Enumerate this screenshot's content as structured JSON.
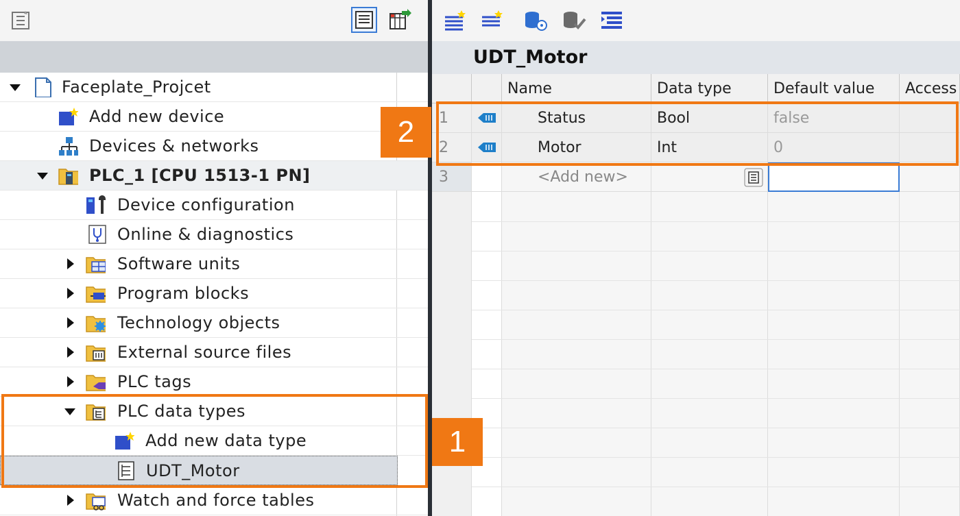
{
  "project_tree": {
    "items": [
      {
        "label": "Faceplate_Projcet",
        "icon": "project-icon",
        "expand": "down"
      },
      {
        "label": "Add new device",
        "icon": "add-new-device-icon",
        "expand": ""
      },
      {
        "label": "Devices & networks",
        "icon": "network-icon",
        "expand": ""
      },
      {
        "label": "PLC_1 [CPU 1513-1 PN]",
        "icon": "plc-folder-icon",
        "expand": "down"
      },
      {
        "label": "Device configuration",
        "icon": "device-config-icon",
        "expand": ""
      },
      {
        "label": "Online & diagnostics",
        "icon": "diagnostics-icon",
        "expand": ""
      },
      {
        "label": "Software units",
        "icon": "software-units-folder-icon",
        "expand": "right"
      },
      {
        "label": "Program blocks",
        "icon": "program-blocks-folder-icon",
        "expand": "right"
      },
      {
        "label": "Technology objects",
        "icon": "technology-objects-folder-icon",
        "expand": "right"
      },
      {
        "label": "External source files",
        "icon": "external-source-folder-icon",
        "expand": "right"
      },
      {
        "label": "PLC tags",
        "icon": "plc-tags-folder-icon",
        "expand": "right"
      },
      {
        "label": "PLC data types",
        "icon": "plc-data-types-folder-icon",
        "expand": "down"
      },
      {
        "label": "Add new data type",
        "icon": "add-new-data-type-icon",
        "expand": ""
      },
      {
        "label": "UDT_Motor",
        "icon": "udt-icon",
        "expand": ""
      },
      {
        "label": "Watch and force tables",
        "icon": "watch-tables-folder-icon",
        "expand": "right"
      }
    ]
  },
  "editor": {
    "title": "UDT_Motor",
    "columns": [
      "Name",
      "Data type",
      "Default value",
      "Access"
    ],
    "rows": [
      {
        "num": "1",
        "name": "Status",
        "type": "Bool",
        "default": "false"
      },
      {
        "num": "2",
        "name": "Motor",
        "type": "Int",
        "default": "0"
      },
      {
        "num": "3",
        "name": "<Add new>",
        "type": "",
        "default": ""
      }
    ]
  },
  "callouts": {
    "one": "1",
    "two": "2"
  },
  "colors": {
    "highlight": "#f07814",
    "selection": "#d9dde3",
    "pane_divider": "#2a2f36"
  }
}
